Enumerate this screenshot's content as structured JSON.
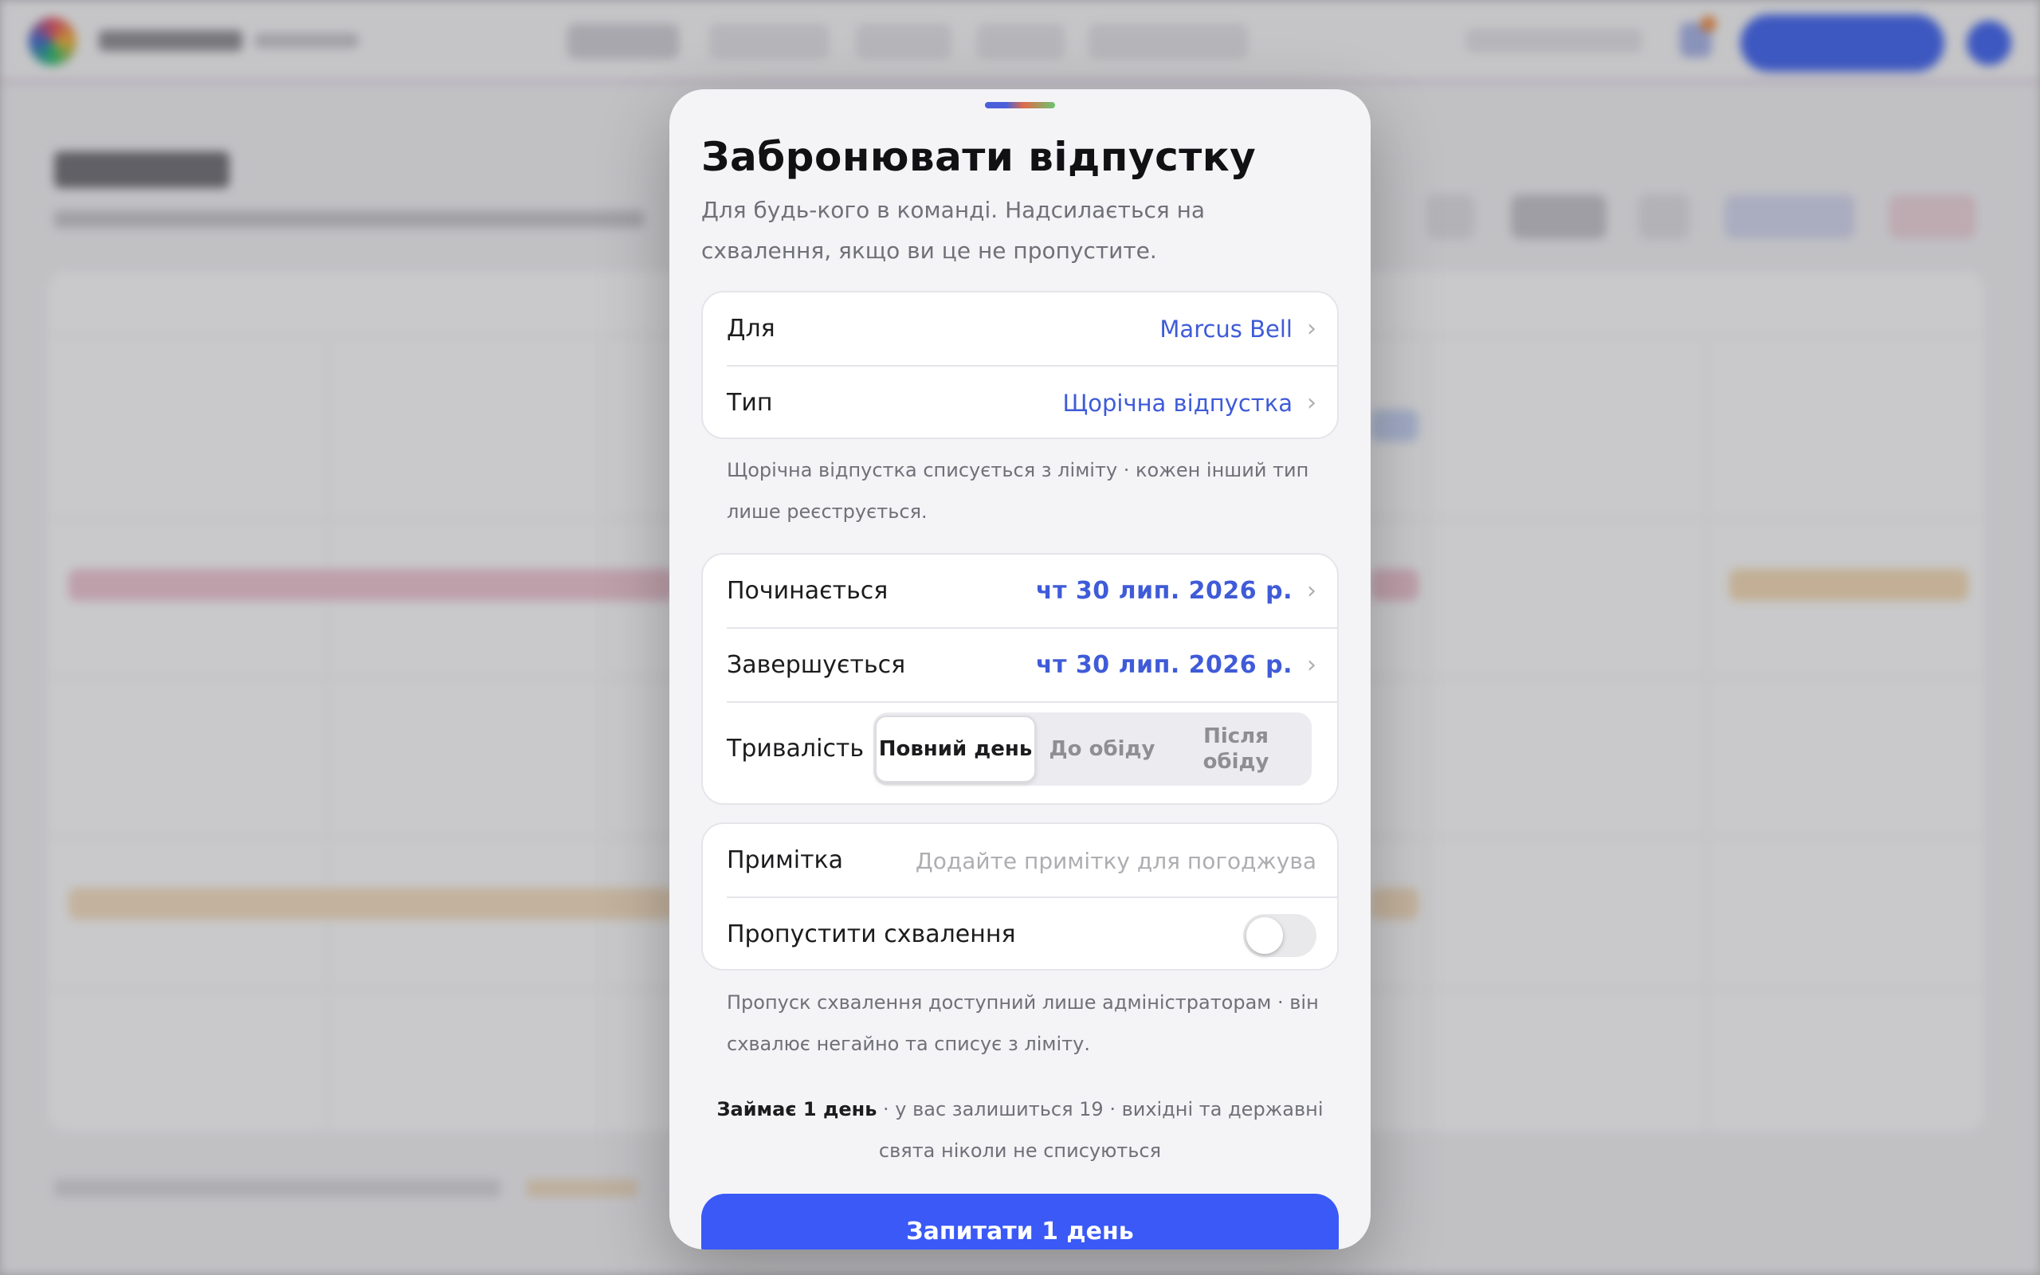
{
  "sheet": {
    "title": "Забронювати відпустку",
    "description": "Для будь-кого в команді. Надсилається на схвалення, якщо ви це не пропустите."
  },
  "who_group": {
    "for_label": "Для",
    "for_value": "Marcus Bell",
    "type_label": "Тип",
    "type_value": "Щорічна відпустка"
  },
  "type_note": "Щорічна відпустка списується з ліміту · кожен інший тип лише реєструється.",
  "dates_group": {
    "start_label": "Починається",
    "start_value": "чт 30 лип. 2026 р.",
    "end_label": "Завершується",
    "end_value": "чт 30 лип. 2026 р.",
    "duration_label": "Тривалість",
    "duration_options": [
      "Повний день",
      "До обіду",
      "Після обіду"
    ],
    "duration_selected": "Повний день"
  },
  "note_group": {
    "note_label": "Примітка",
    "note_value": "",
    "note_placeholder": "Додайте примітку для погоджува",
    "skip_label": "Пропустити схвалення",
    "skip_enabled": false
  },
  "skip_note": "Пропуск схвалення доступний лише адміністраторам · він схвалює негайно та списує з ліміту.",
  "summary": {
    "bold": "Займає 1 день",
    "rest": " · у вас залишиться 19 · вихідні та державні свята ніколи не списуються"
  },
  "submit_label": "Запитати 1 день",
  "colors": {
    "accent": "#3a59f7",
    "value_blue": "#3f5bd8"
  }
}
